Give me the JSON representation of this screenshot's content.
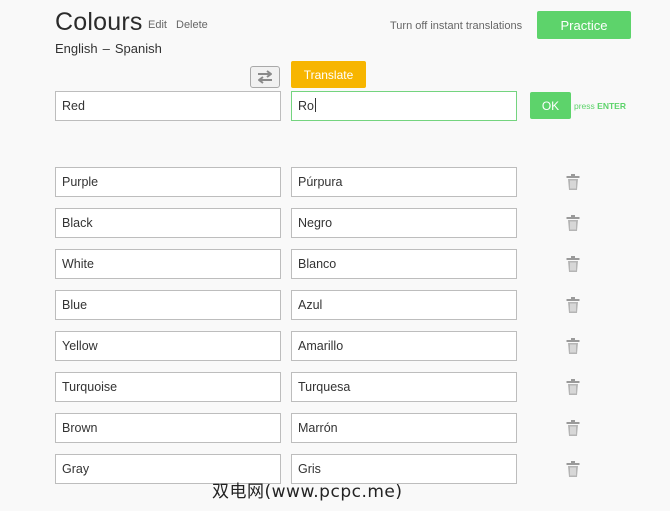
{
  "header": {
    "title": "Colours",
    "edit_label": "Edit",
    "delete_label": "Delete",
    "source_language": "English",
    "separator": "–",
    "target_language": "Spanish",
    "turn_off_label": "Turn off instant translations",
    "practice_label": "Practice"
  },
  "entry": {
    "swap_icon": "swap-arrows-icon",
    "translate_label": "Translate",
    "source_value": "Red",
    "target_value": "Ro",
    "ok_label": "OK",
    "press_label": "press",
    "enter_label": "ENTER"
  },
  "words": [
    {
      "source": "Purple",
      "target": "Púrpura"
    },
    {
      "source": "Black",
      "target": "Negro"
    },
    {
      "source": "White",
      "target": "Blanco"
    },
    {
      "source": "Blue",
      "target": "Azul"
    },
    {
      "source": "Yellow",
      "target": "Amarillo"
    },
    {
      "source": "Turquoise",
      "target": "Turquesa"
    },
    {
      "source": "Brown",
      "target": "Marrón"
    },
    {
      "source": "Gray",
      "target": "Gris"
    }
  ],
  "watermark": "双电网(www.pcpc.me)",
  "colors": {
    "accent_green": "#5dd36b",
    "translate_orange": "#f7b500",
    "background": "#f9f9f9"
  }
}
